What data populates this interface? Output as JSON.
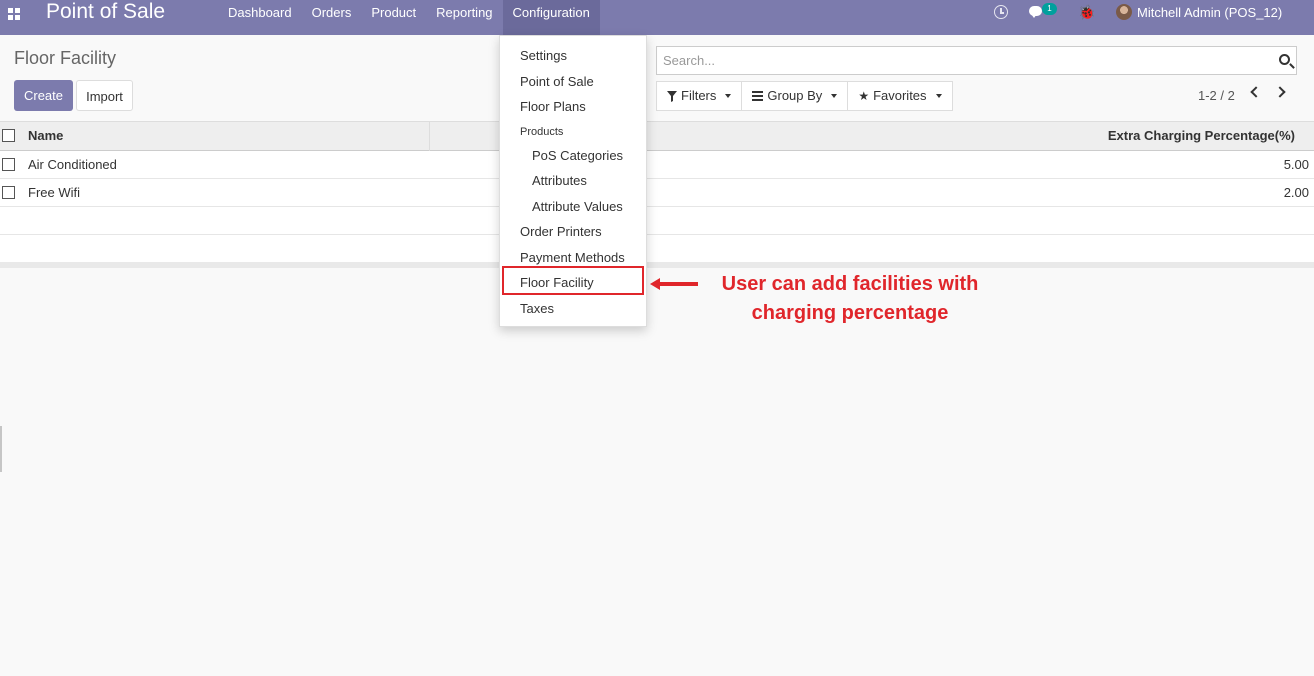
{
  "navbar": {
    "app_title": "Point of Sale",
    "menu": [
      "Dashboard",
      "Orders",
      "Product",
      "Reporting",
      "Configuration"
    ],
    "chat_count": "1",
    "user": "Mitchell Admin (POS_12)"
  },
  "breadcrumb": "Floor Facility",
  "buttons": {
    "create": "Create",
    "import": "Import"
  },
  "search": {
    "placeholder": "Search..."
  },
  "filters": {
    "filters": "Filters",
    "group_by": "Group By",
    "favorites": "Favorites"
  },
  "pager": "1-2 / 2",
  "table": {
    "columns": [
      "Name",
      "Extra Charging Percentage(%)"
    ],
    "rows": [
      {
        "name": "Air Conditioned",
        "value": "5.00"
      },
      {
        "name": "Free Wifi",
        "value": "2.00"
      }
    ]
  },
  "dropdown": {
    "settings": "Settings",
    "point_of_sale": "Point of Sale",
    "floor_plans": "Floor Plans",
    "products_header": "Products",
    "pos_categories": "PoS Categories",
    "attributes": "Attributes",
    "attribute_values": "Attribute Values",
    "order_printers": "Order Printers",
    "payment_methods": "Payment Methods",
    "floor_facility": "Floor Facility",
    "taxes": "Taxes"
  },
  "annotation": {
    "line1": "User can add facilities with",
    "line2": "charging percentage"
  },
  "colors": {
    "brand": "#7c7bad",
    "annotation": "#e0262b",
    "badge": "#00a09d"
  }
}
